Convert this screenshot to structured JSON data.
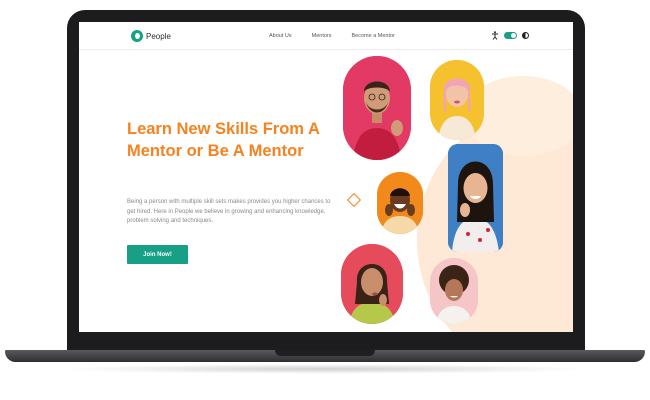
{
  "nav": {
    "logo_text": "People",
    "links": [
      "About Us",
      "Mentors",
      "Become a Mentor"
    ]
  },
  "hero": {
    "title": "Learn New Skills From A Mentor or Be A Mentor",
    "description": "Being a person with multiple skill sets makes provides you higher chances to get hired. Here in People we believe in growing and enhancing knowledge, problem solving and techniques.",
    "cta_label": "Join Now!"
  },
  "colors": {
    "brand": "#17a085",
    "accent": "#f4831f",
    "lid": "#1c1c1e"
  },
  "icons": [
    "accessibility-icon",
    "theme-toggle",
    "contrast-icon",
    "diamond-decoration"
  ]
}
